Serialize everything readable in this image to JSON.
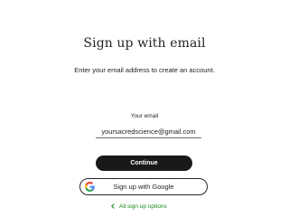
{
  "page": {
    "title": "Sign up with email",
    "subtitle": "Enter your email address to create an account."
  },
  "form": {
    "email_label": "Your email",
    "email_value": "yoursacredscience@gmail.com"
  },
  "actions": {
    "continue_label": "Continue",
    "google_label": "Sign up with Google",
    "back_label": "All sign up options"
  },
  "icons": {
    "google": "google-icon",
    "back": "chevron-left-icon"
  },
  "colors": {
    "primary_text": "#242424",
    "button_bg": "#191919",
    "button_text": "#ffffff",
    "link_green": "#1a8917",
    "google_blue": "#4285F4",
    "google_red": "#EA4335",
    "google_yellow": "#FBBC05",
    "google_green": "#34A853"
  }
}
